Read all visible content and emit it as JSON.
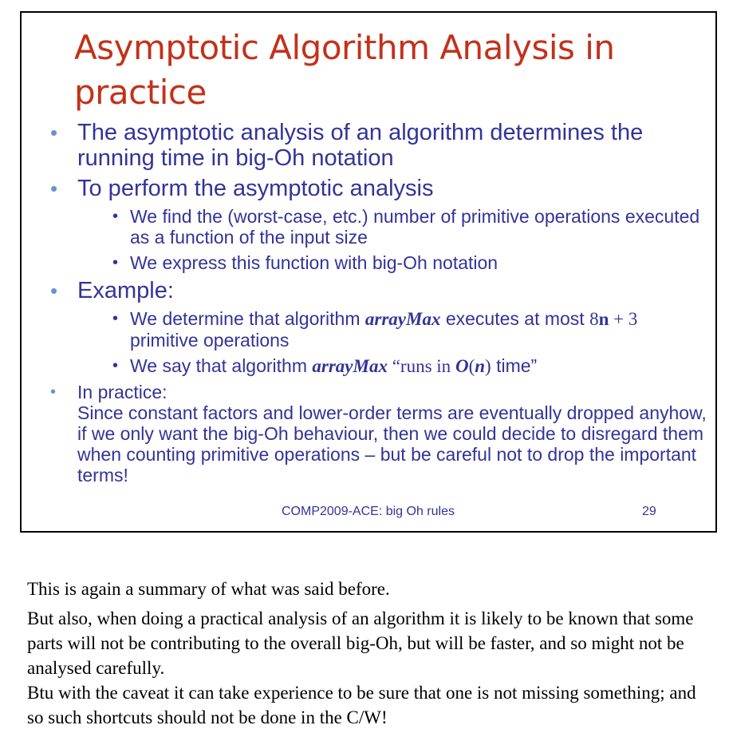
{
  "slide": {
    "title": "Asymptotic Algorithm Analysis in practice",
    "bullet1": "The asymptotic analysis of an algorithm determines the running time in big-Oh notation",
    "bullet2": "To perform the asymptotic analysis",
    "bullet2_sub1": "We find the (worst-case, etc.) number of primitive operations executed as a function of the input size",
    "bullet2_sub2": "We express this function with big-Oh notation",
    "bullet3": "Example:",
    "bullet3_sub1_a": "We determine that algorithm ",
    "bullet3_sub1_alg": "arrayMax",
    "bullet3_sub1_b": " executes at most ",
    "bullet3_sub1_expr_8": "8",
    "bullet3_sub1_expr_n": "n",
    "bullet3_sub1_expr_rest": " + 3",
    "bullet3_sub1_c": " primitive operations",
    "bullet3_sub2_a": "We say that algorithm ",
    "bullet3_sub2_alg": "arrayMax",
    "bullet3_sub2_b": " “runs in ",
    "bullet3_sub2_O": "O",
    "bullet3_sub2_paren_open": "(",
    "bullet3_sub2_n": "n",
    "bullet3_sub2_paren_close": ")",
    "bullet3_sub2_c": " time”",
    "bullet4_head": "In practice:",
    "bullet4_body": "Since constant factors and lower-order terms are eventually dropped anyhow, if we only want the big-Oh behaviour, then we could decide to disregard them when counting primitive operations – but be careful not to drop the important terms!",
    "footer": "COMP2009-ACE: big Oh rules",
    "page_number": "29"
  },
  "notes": {
    "para1": "This is again a summary of what was said before.",
    "para2_line1": "But also, when doing a practical analysis of an algorithm it is likely to be known that some parts will not be contributing to the overall big-Oh, but will be faster, and so might not be analysed carefully.",
    "para2_line2": "Btu with the caveat it can take experience to be sure that one is not missing something; and so such shortcuts should not be done in the C/W!"
  },
  "colors": {
    "title": "#c3311a",
    "body": "#333399",
    "bullet_level1": "#6b8fd6"
  }
}
